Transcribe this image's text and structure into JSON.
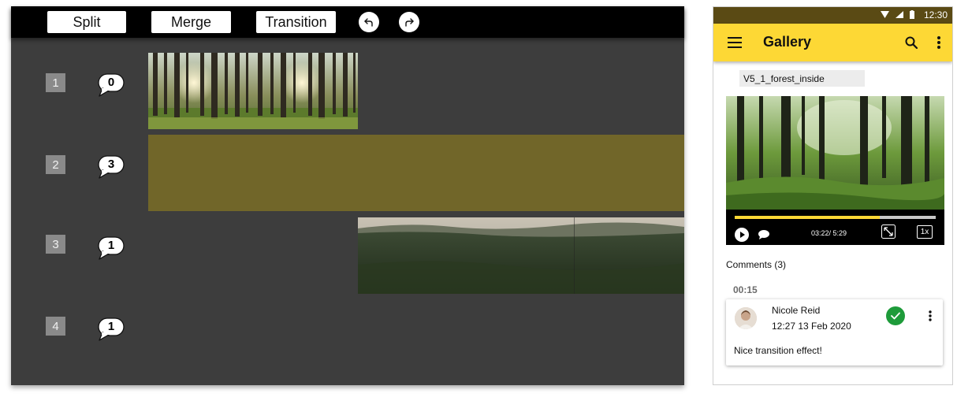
{
  "toolbar": {
    "split_label": "Split",
    "merge_label": "Merge",
    "transition_label": "Transition",
    "undo_icon": "undo-icon",
    "redo_icon": "redo-icon"
  },
  "tracks": [
    {
      "number": "1",
      "comments": "0"
    },
    {
      "number": "2",
      "comments": "3"
    },
    {
      "number": "3",
      "comments": "1"
    },
    {
      "number": "4",
      "comments": "1"
    }
  ],
  "colors": {
    "editor_bg": "#3d3d3d",
    "transition_clip": "#716629",
    "app_bar": "#fdd835",
    "status_bar": "#5a4a14",
    "check": "#1e9b3a"
  },
  "phone": {
    "status_time": "12:30",
    "app_title": "Gallery",
    "file_name": "V5_1_forest_inside",
    "player": {
      "time": "03:22/ 5:29",
      "speed": "1x",
      "progress": 0.72
    },
    "comments_title": "Comments (3)",
    "timestamp": "00:15",
    "comment": {
      "author": "Nicole Reid",
      "time": "12:27 13 Feb 2020",
      "text": "Nice transition effect!"
    }
  }
}
